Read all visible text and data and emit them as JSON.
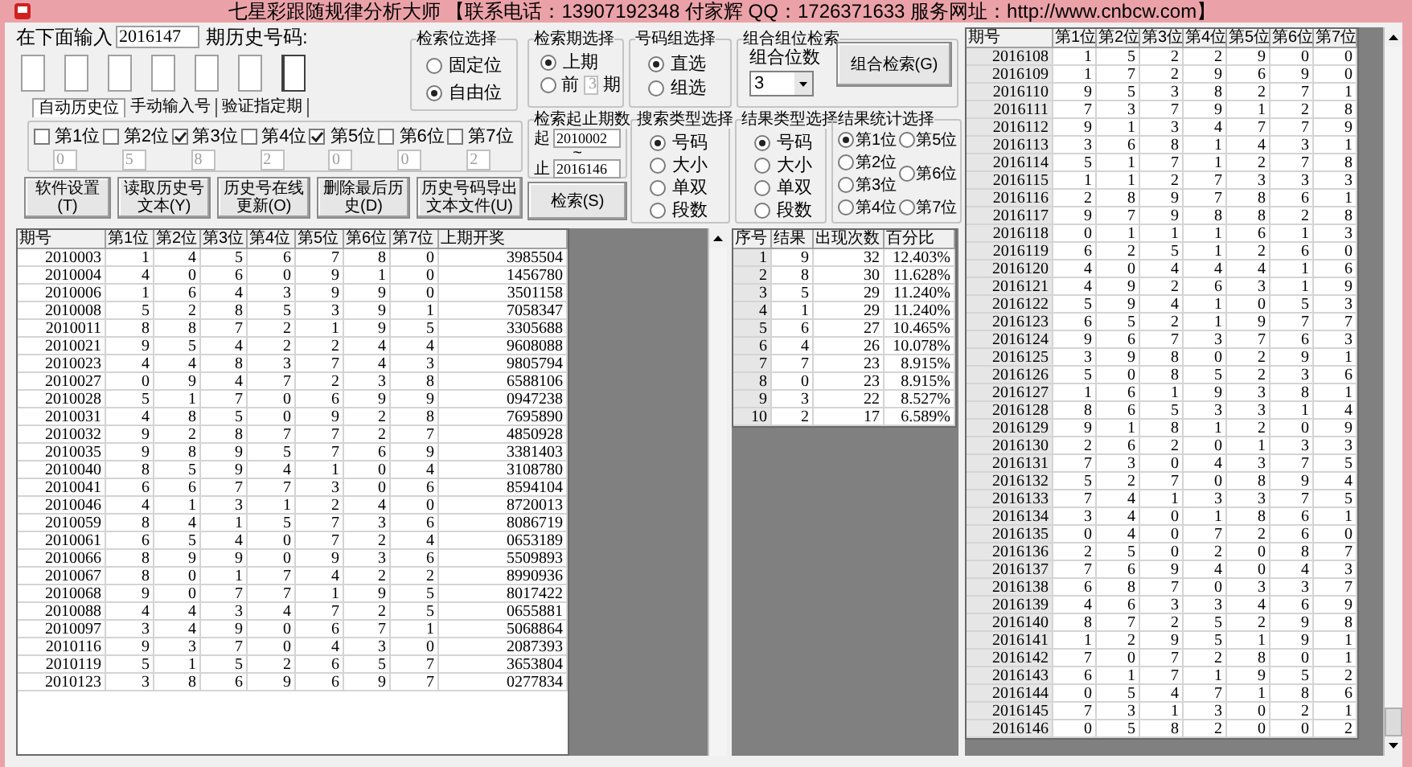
{
  "window": {
    "title": "七星彩跟随规律分析大师 【联系电话：13907192348 付家辉 QQ：1726371633 服务网址：http://www.cnbcw.com】"
  },
  "history_input": {
    "label": "在下面输入",
    "value": "2016147",
    "suffix": "期历史号码:"
  },
  "digit_fields": [
    {
      "focused": false
    },
    {
      "focused": false
    },
    {
      "focused": false
    },
    {
      "focused": false
    },
    {
      "focused": false
    },
    {
      "focused": false
    },
    {
      "focused": true
    }
  ],
  "tabs": [
    {
      "label": "自动历史位",
      "selected": true
    },
    {
      "label": "手动输入号",
      "selected": false
    },
    {
      "label": "验证指定期",
      "selected": false
    }
  ],
  "positions": [
    {
      "label": "第1位",
      "checked": false,
      "value": "0"
    },
    {
      "label": "第2位",
      "checked": false,
      "value": "5"
    },
    {
      "label": "第3位",
      "checked": true,
      "value": "8"
    },
    {
      "label": "第4位",
      "checked": false,
      "value": "2"
    },
    {
      "label": "第5位",
      "checked": true,
      "value": "0"
    },
    {
      "label": "第6位",
      "checked": false,
      "value": "0"
    },
    {
      "label": "第7位",
      "checked": false,
      "value": "2"
    }
  ],
  "buttons": [
    {
      "label": "软件设置(T)"
    },
    {
      "label": "读取历史号文本(Y)"
    },
    {
      "label": "历史号在线更新(O)"
    },
    {
      "label": "删除最后历史(D)"
    },
    {
      "label": "历史号码导出文本文件(U)"
    }
  ],
  "search_position": {
    "title": "检索位选择",
    "options": [
      {
        "label": "固定位",
        "selected": false
      },
      {
        "label": "自由位",
        "selected": true
      }
    ]
  },
  "search_period": {
    "title": "检索期选择",
    "options": [
      {
        "kind": "plain",
        "label": "上期",
        "selected": true
      },
      {
        "kind": "count",
        "prefix": "前",
        "value": "3",
        "suffix": "期",
        "selected": false
      }
    ]
  },
  "number_group": {
    "title": "号码组选择",
    "options": [
      {
        "label": "直选",
        "selected": true
      },
      {
        "label": "组选",
        "selected": false
      }
    ]
  },
  "combo_search": {
    "title": "组合组位检索",
    "count_label": "组合位数",
    "count_value": "3",
    "button": "组合检索(G)"
  },
  "period_range": {
    "title": "检索起止期数",
    "from_label": "起",
    "from_value": "2010002",
    "separator": "~",
    "to_label": "止",
    "to_value": "2016146"
  },
  "search_button": "检索(S)",
  "search_type": {
    "title": "搜索类型选择",
    "options": [
      {
        "label": "号码",
        "selected": true
      },
      {
        "label": "大小",
        "selected": false
      },
      {
        "label": "单双",
        "selected": false
      },
      {
        "label": "段数",
        "selected": false
      }
    ]
  },
  "result_type": {
    "title": "结果类型选择",
    "options": [
      {
        "label": "号码",
        "selected": true
      },
      {
        "label": "大小",
        "selected": false
      },
      {
        "label": "单双",
        "selected": false
      },
      {
        "label": "段数",
        "selected": false
      }
    ]
  },
  "result_stats": {
    "title": "结果统计选择",
    "options": [
      {
        "label": "第1位",
        "selected": true
      },
      {
        "label": "第2位",
        "selected": false
      },
      {
        "label": "第3位",
        "selected": false
      },
      {
        "label": "第4位",
        "selected": false
      },
      {
        "label": "第5位",
        "selected": false
      },
      {
        "label": "第6位",
        "selected": false
      },
      {
        "label": "第7位",
        "selected": false
      }
    ]
  },
  "history_table": {
    "columns": [
      "期号",
      "第1位",
      "第2位",
      "第3位",
      "第4位",
      "第5位",
      "第6位",
      "第7位",
      "上期开奖"
    ],
    "rows": [
      [
        "2010003",
        "1",
        "4",
        "5",
        "6",
        "7",
        "8",
        "0",
        "3985504"
      ],
      [
        "2010004",
        "4",
        "0",
        "6",
        "0",
        "9",
        "1",
        "0",
        "1456780"
      ],
      [
        "2010006",
        "1",
        "6",
        "4",
        "3",
        "9",
        "9",
        "0",
        "3501158"
      ],
      [
        "2010008",
        "5",
        "2",
        "8",
        "5",
        "3",
        "9",
        "1",
        "7058347"
      ],
      [
        "2010011",
        "8",
        "8",
        "7",
        "2",
        "1",
        "9",
        "5",
        "3305688"
      ],
      [
        "2010021",
        "9",
        "5",
        "4",
        "2",
        "2",
        "4",
        "4",
        "9608088"
      ],
      [
        "2010023",
        "4",
        "4",
        "8",
        "3",
        "7",
        "4",
        "3",
        "9805794"
      ],
      [
        "2010027",
        "0",
        "9",
        "4",
        "7",
        "2",
        "3",
        "8",
        "6588106"
      ],
      [
        "2010028",
        "5",
        "1",
        "7",
        "0",
        "6",
        "9",
        "9",
        "0947238"
      ],
      [
        "2010031",
        "4",
        "8",
        "5",
        "0",
        "9",
        "2",
        "8",
        "7695890"
      ],
      [
        "2010032",
        "9",
        "2",
        "8",
        "7",
        "7",
        "2",
        "7",
        "4850928"
      ],
      [
        "2010035",
        "9",
        "8",
        "9",
        "5",
        "7",
        "6",
        "9",
        "3381403"
      ],
      [
        "2010040",
        "8",
        "5",
        "9",
        "4",
        "1",
        "0",
        "4",
        "3108780"
      ],
      [
        "2010041",
        "6",
        "6",
        "7",
        "7",
        "3",
        "0",
        "6",
        "8594104"
      ],
      [
        "2010046",
        "4",
        "1",
        "3",
        "1",
        "2",
        "4",
        "0",
        "8720013"
      ],
      [
        "2010059",
        "8",
        "4",
        "1",
        "5",
        "7",
        "3",
        "6",
        "8086719"
      ],
      [
        "2010061",
        "6",
        "5",
        "4",
        "0",
        "7",
        "2",
        "4",
        "0653189"
      ],
      [
        "2010066",
        "8",
        "9",
        "9",
        "0",
        "9",
        "3",
        "6",
        "5509893"
      ],
      [
        "2010067",
        "8",
        "0",
        "1",
        "7",
        "4",
        "2",
        "2",
        "8990936"
      ],
      [
        "2010068",
        "9",
        "0",
        "7",
        "7",
        "1",
        "9",
        "5",
        "8017422"
      ],
      [
        "2010088",
        "4",
        "4",
        "3",
        "4",
        "7",
        "2",
        "5",
        "0655881"
      ],
      [
        "2010097",
        "3",
        "4",
        "9",
        "0",
        "6",
        "7",
        "1",
        "5068864"
      ],
      [
        "2010116",
        "9",
        "3",
        "7",
        "0",
        "4",
        "3",
        "0",
        "2087393"
      ],
      [
        "2010119",
        "5",
        "1",
        "5",
        "2",
        "6",
        "5",
        "7",
        "3653804"
      ],
      [
        "2010123",
        "3",
        "8",
        "6",
        "9",
        "6",
        "9",
        "7",
        "0277834"
      ]
    ]
  },
  "stats_table": {
    "columns": [
      "序号",
      "结果",
      "出现次数",
      "百分比"
    ],
    "rows": [
      [
        "1",
        "9",
        "32",
        "12.403%"
      ],
      [
        "2",
        "8",
        "30",
        "11.628%"
      ],
      [
        "3",
        "5",
        "29",
        "11.240%"
      ],
      [
        "4",
        "1",
        "29",
        "11.240%"
      ],
      [
        "5",
        "6",
        "27",
        "10.465%"
      ],
      [
        "6",
        "4",
        "26",
        "10.078%"
      ],
      [
        "7",
        "7",
        "23",
        "8.915%"
      ],
      [
        "8",
        "0",
        "23",
        "8.915%"
      ],
      [
        "9",
        "3",
        "22",
        "8.527%"
      ],
      [
        "10",
        "2",
        "17",
        "6.589%"
      ]
    ]
  },
  "recent_table": {
    "columns": [
      "期号",
      "第1位",
      "第2位",
      "第3位",
      "第4位",
      "第5位",
      "第6位",
      "第7位"
    ],
    "rows": [
      [
        "2016108",
        "1",
        "5",
        "2",
        "2",
        "9",
        "0",
        "0"
      ],
      [
        "2016109",
        "1",
        "7",
        "2",
        "9",
        "6",
        "9",
        "0"
      ],
      [
        "2016110",
        "9",
        "5",
        "3",
        "8",
        "2",
        "7",
        "1"
      ],
      [
        "2016111",
        "7",
        "3",
        "7",
        "9",
        "1",
        "2",
        "8"
      ],
      [
        "2016112",
        "9",
        "1",
        "3",
        "4",
        "7",
        "7",
        "9"
      ],
      [
        "2016113",
        "3",
        "6",
        "8",
        "1",
        "4",
        "3",
        "1"
      ],
      [
        "2016114",
        "5",
        "1",
        "7",
        "1",
        "2",
        "7",
        "8"
      ],
      [
        "2016115",
        "1",
        "1",
        "2",
        "7",
        "3",
        "3",
        "3"
      ],
      [
        "2016116",
        "2",
        "8",
        "9",
        "7",
        "8",
        "6",
        "1"
      ],
      [
        "2016117",
        "9",
        "7",
        "9",
        "8",
        "8",
        "2",
        "8"
      ],
      [
        "2016118",
        "0",
        "1",
        "1",
        "1",
        "6",
        "1",
        "3"
      ],
      [
        "2016119",
        "6",
        "2",
        "5",
        "1",
        "2",
        "6",
        "0"
      ],
      [
        "2016120",
        "4",
        "0",
        "4",
        "4",
        "4",
        "1",
        "6"
      ],
      [
        "2016121",
        "4",
        "9",
        "2",
        "6",
        "3",
        "1",
        "9"
      ],
      [
        "2016122",
        "5",
        "9",
        "4",
        "1",
        "0",
        "5",
        "3"
      ],
      [
        "2016123",
        "6",
        "5",
        "2",
        "1",
        "9",
        "7",
        "7"
      ],
      [
        "2016124",
        "9",
        "6",
        "7",
        "3",
        "7",
        "6",
        "3"
      ],
      [
        "2016125",
        "3",
        "9",
        "8",
        "0",
        "2",
        "9",
        "1"
      ],
      [
        "2016126",
        "5",
        "0",
        "8",
        "5",
        "2",
        "3",
        "6"
      ],
      [
        "2016127",
        "1",
        "6",
        "1",
        "9",
        "3",
        "8",
        "1"
      ],
      [
        "2016128",
        "8",
        "6",
        "5",
        "3",
        "3",
        "1",
        "4"
      ],
      [
        "2016129",
        "9",
        "1",
        "8",
        "1",
        "2",
        "0",
        "9"
      ],
      [
        "2016130",
        "2",
        "6",
        "2",
        "0",
        "1",
        "3",
        "3"
      ],
      [
        "2016131",
        "7",
        "3",
        "0",
        "4",
        "3",
        "7",
        "5"
      ],
      [
        "2016132",
        "5",
        "2",
        "7",
        "0",
        "8",
        "9",
        "4"
      ],
      [
        "2016133",
        "7",
        "4",
        "1",
        "3",
        "3",
        "7",
        "5"
      ],
      [
        "2016134",
        "3",
        "4",
        "0",
        "1",
        "8",
        "6",
        "1"
      ],
      [
        "2016135",
        "0",
        "4",
        "0",
        "7",
        "2",
        "6",
        "0"
      ],
      [
        "2016136",
        "2",
        "5",
        "0",
        "2",
        "0",
        "8",
        "7"
      ],
      [
        "2016137",
        "7",
        "6",
        "9",
        "4",
        "0",
        "4",
        "3"
      ],
      [
        "2016138",
        "6",
        "8",
        "7",
        "0",
        "3",
        "3",
        "7"
      ],
      [
        "2016139",
        "4",
        "6",
        "3",
        "3",
        "4",
        "6",
        "9"
      ],
      [
        "2016140",
        "8",
        "7",
        "2",
        "5",
        "2",
        "9",
        "8"
      ],
      [
        "2016141",
        "1",
        "2",
        "9",
        "5",
        "1",
        "9",
        "1"
      ],
      [
        "2016142",
        "7",
        "0",
        "7",
        "2",
        "8",
        "0",
        "1"
      ],
      [
        "2016143",
        "6",
        "1",
        "7",
        "1",
        "9",
        "5",
        "2"
      ],
      [
        "2016144",
        "0",
        "5",
        "4",
        "7",
        "1",
        "8",
        "6"
      ],
      [
        "2016145",
        "7",
        "3",
        "1",
        "3",
        "0",
        "2",
        "1"
      ],
      [
        "2016146",
        "0",
        "5",
        "8",
        "2",
        "0",
        "0",
        "2"
      ]
    ]
  }
}
